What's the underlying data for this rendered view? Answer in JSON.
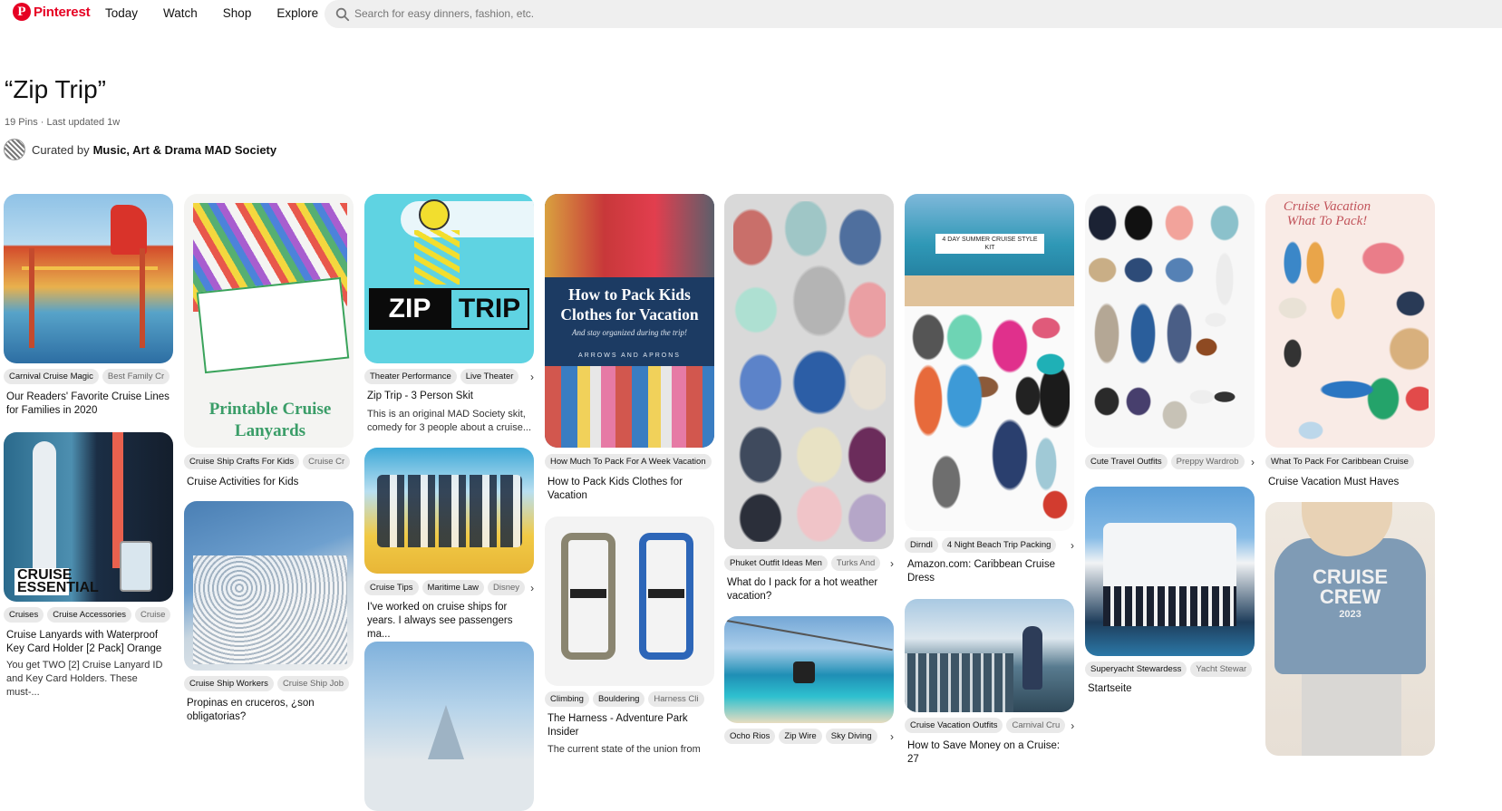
{
  "header": {
    "logo_text": "Pinterest",
    "nav": [
      "Today",
      "Watch",
      "Shop",
      "Explore"
    ],
    "search_placeholder": "Search for easy dinners, fashion, etc."
  },
  "board": {
    "title": "“Zip Trip”",
    "meta": "19 Pins · Last updated 1w",
    "curated_prefix": "Curated by",
    "curator": "Music, Art & Drama MAD Society"
  },
  "pins": {
    "p1": {
      "tags": [
        "Carnival Cruise Magic",
        "Best Family Cr"
      ],
      "title": "Our Readers' Favorite Cruise Lines for Families in 2020"
    },
    "p2": {
      "image_text": "CRUISE ESSENTIAL",
      "tags": [
        "Cruises",
        "Cruise Accessories",
        "Cruise"
      ],
      "title": "Cruise Lanyards with Waterproof Key Card Holder [2 Pack] Orange",
      "desc": "You get TWO [2] Cruise Lanyard ID and Key Card Holders. These must-..."
    },
    "p3": {
      "image_text": "Printable Cruise Lanyards",
      "tags": [
        "Cruise Ship Crafts For Kids",
        "Cruise Cr"
      ],
      "title": "Cruise Activities for Kids"
    },
    "p4": {
      "tags": [
        "Cruise Ship Workers",
        "Cruise Ship Job"
      ],
      "title": "Propinas en cruceros, ¿son obligatorias?"
    },
    "p5": {
      "image_text_a": "ZIP",
      "image_text_b": "TRIP",
      "tags": [
        "Theater Performance",
        "Live Theater"
      ],
      "title": "Zip Trip - 3 Person Skit",
      "desc": "This is an original MAD Society skit, comedy for 3 people about a cruise..."
    },
    "p6": {
      "tags": [
        "Cruise Tips",
        "Maritime Law",
        "Disney"
      ],
      "title": "I've worked on cruise ships for years. I always see passengers ma..."
    },
    "p8": {
      "image_title": "How to Pack Kids Clothes for Vacation",
      "image_sub": "And stay organized during the trip!",
      "image_brand": "ARROWS AND APRONS",
      "tags": [
        "How Much To Pack For A Week Vacation"
      ],
      "title": "How to Pack Kids Clothes for Vacation"
    },
    "p9": {
      "tags": [
        "Climbing",
        "Bouldering",
        "Harness Cli"
      ],
      "title": "The Harness - Adventure Park Insider",
      "desc": "The current state of the union from"
    },
    "p10": {
      "tags": [
        "Phuket Outfit Ideas Men",
        "Turks And"
      ],
      "title": "What do I pack for a hot weather vacation?"
    },
    "p11": {
      "tags": [
        "Ocho Rios",
        "Zip Wire",
        "Sky Diving"
      ]
    },
    "p12": {
      "image_text": "4 DAY SUMMER CRUISE STYLE KIT",
      "tags": [
        "Dirndl",
        "4 Night Beach Trip Packing"
      ],
      "title": "Amazon.com: Caribbean Cruise Dress"
    },
    "p13": {
      "tags": [
        "Cruise Vacation Outfits",
        "Carnival Cru"
      ],
      "title": "How to Save Money on a Cruise: 27"
    },
    "p14": {
      "tags": [
        "Cute Travel Outfits",
        "Preppy Wardrob"
      ]
    },
    "p15": {
      "tags": [
        "Superyacht Stewardess",
        "Yacht Stewar"
      ],
      "title": "Startseite"
    },
    "p16": {
      "image_title": "Cruise Vacation What To Pack!",
      "tags": [
        "What To Pack For Caribbean Cruise"
      ],
      "title": "Cruise Vacation Must Haves"
    },
    "p17": {
      "image_text_a": "CRUISE",
      "image_text_b": "CREW",
      "image_text_c": "2023"
    }
  }
}
